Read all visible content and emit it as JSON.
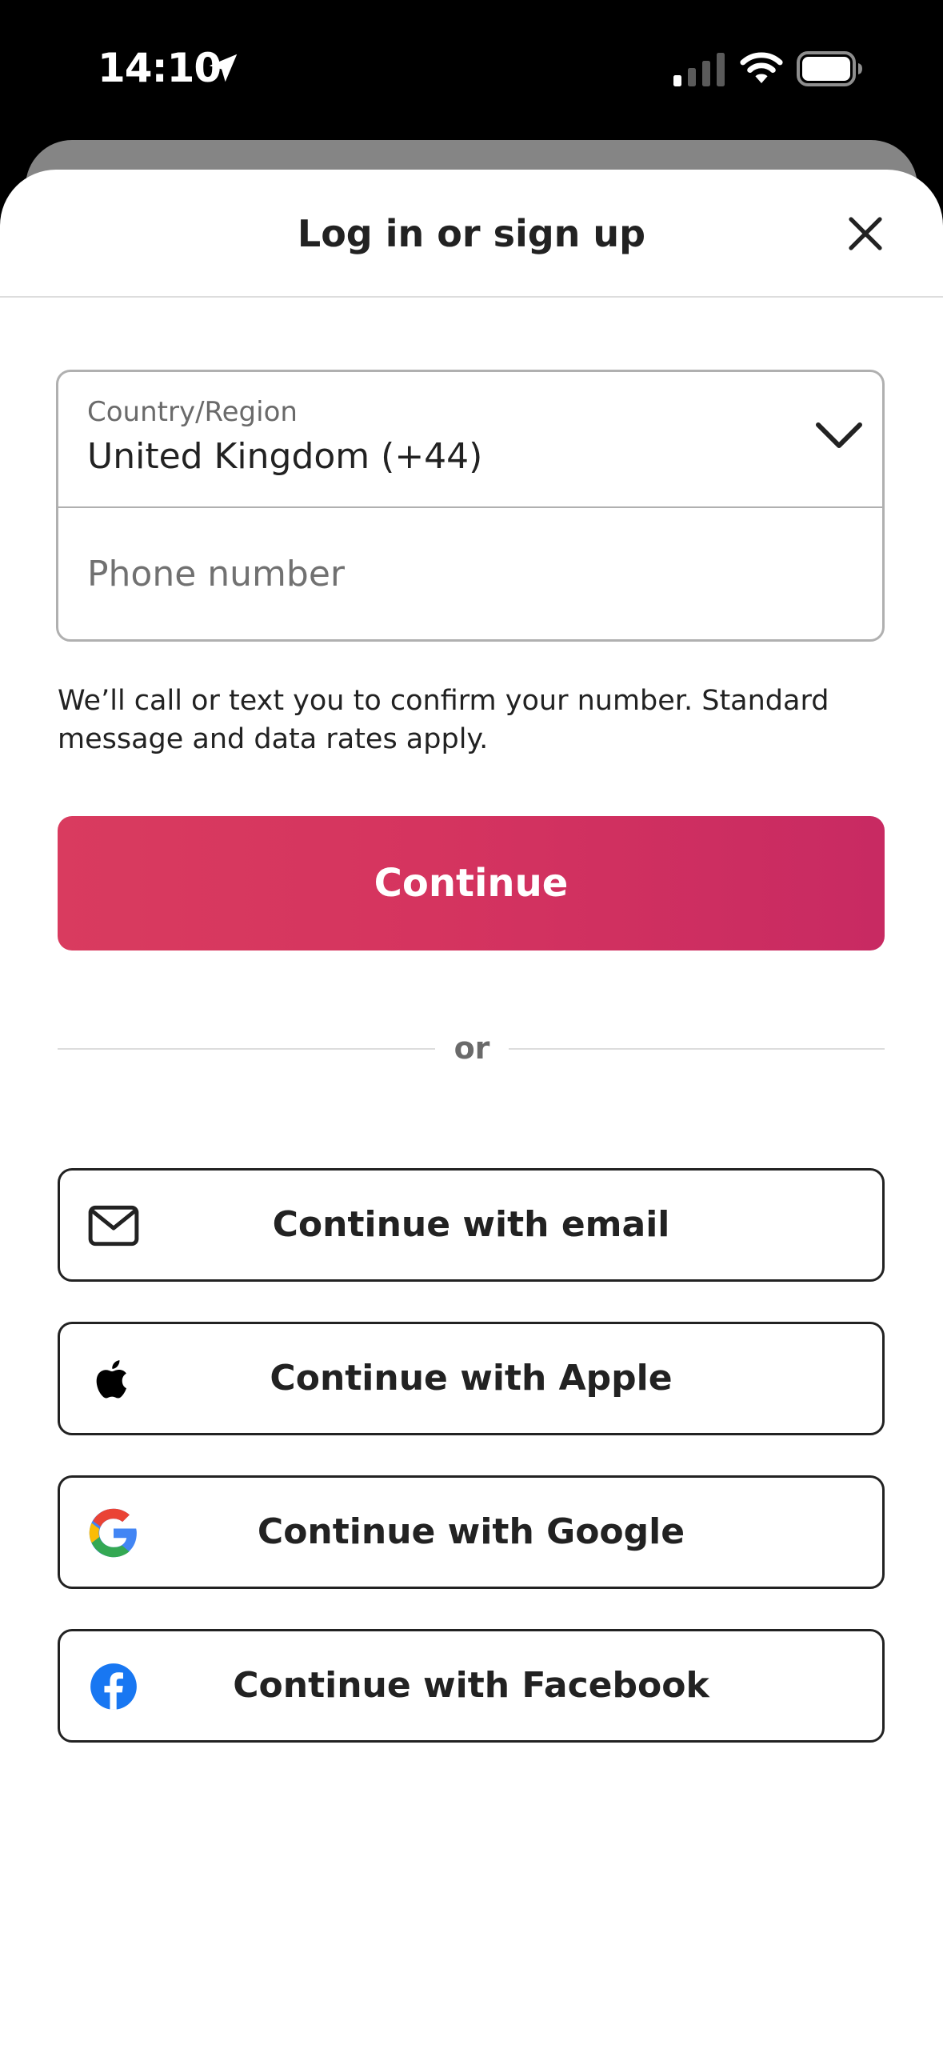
{
  "status_bar": {
    "time": "14:10",
    "icons": [
      "location-arrow-icon",
      "cellular-signal-icon",
      "wifi-icon",
      "battery-icon"
    ]
  },
  "sheet": {
    "title": "Log in or sign up",
    "close_icon": "close-icon"
  },
  "form": {
    "country_label": "Country/Region",
    "country_value": "United Kingdom (+44)",
    "phone_placeholder": "Phone number",
    "phone_value": "",
    "disclaimer": "We’ll call or text you to confirm your number. Standard message and data rates apply.",
    "continue_label": "Continue"
  },
  "divider": {
    "text": "or"
  },
  "social": [
    {
      "label": "Continue with email",
      "icon": "email-icon"
    },
    {
      "label": "Continue with Apple",
      "icon": "apple-icon"
    },
    {
      "label": "Continue with Google",
      "icon": "google-icon"
    },
    {
      "label": "Continue with Facebook",
      "icon": "facebook-icon"
    }
  ],
  "colors": {
    "accent_start": "#d93b5f",
    "accent_end": "#c82a62",
    "text_primary": "#222222",
    "text_secondary": "#6a6a6a",
    "border": "#b0b0b0",
    "google_blue": "#4285f4",
    "google_red": "#ea4335",
    "google_yellow": "#fbbc05",
    "google_green": "#34a853",
    "facebook_blue": "#1877f2"
  }
}
